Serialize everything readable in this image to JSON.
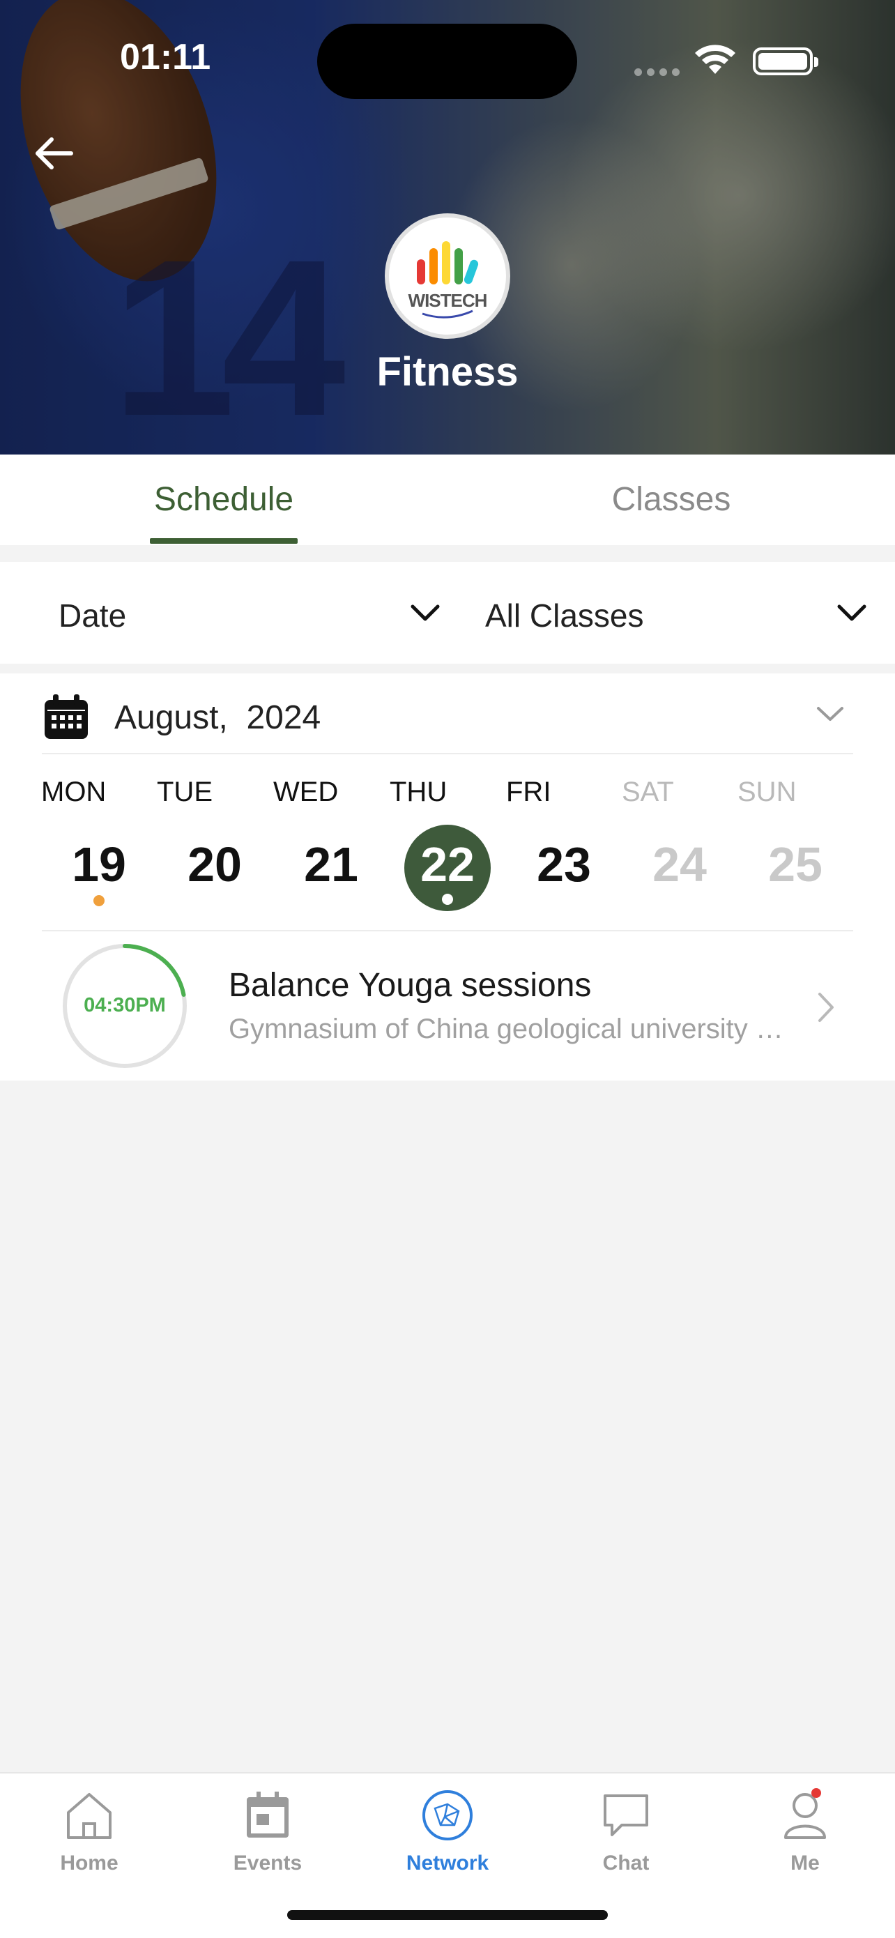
{
  "status_bar": {
    "time": "01:11"
  },
  "header": {
    "title": "Fitness",
    "logo_text": "WISTECH"
  },
  "tabs": [
    {
      "label": "Schedule",
      "active": true
    },
    {
      "label": "Classes",
      "active": false
    }
  ],
  "filters": {
    "date_label": "Date",
    "class_label": "All Classes"
  },
  "calendar": {
    "month_label": "August,  2024",
    "days": [
      {
        "name": "MON",
        "num": "19",
        "weekend": false,
        "selected": false,
        "dot": "#f0a03c"
      },
      {
        "name": "TUE",
        "num": "20",
        "weekend": false,
        "selected": false
      },
      {
        "name": "WED",
        "num": "21",
        "weekend": false,
        "selected": false
      },
      {
        "name": "THU",
        "num": "22",
        "weekend": false,
        "selected": true,
        "dot": "#ffffff"
      },
      {
        "name": "FRI",
        "num": "23",
        "weekend": false,
        "selected": false
      },
      {
        "name": "SAT",
        "num": "24",
        "weekend": true,
        "selected": false
      },
      {
        "name": "SUN",
        "num": "25",
        "weekend": true,
        "selected": false
      }
    ]
  },
  "event": {
    "time": "04:30PM",
    "title": "Balance Youga sessions",
    "location": "Gymnasium of China geological university Beijing",
    "progress": 0.22
  },
  "nav": [
    {
      "label": "Home",
      "icon": "home-icon",
      "active": false
    },
    {
      "label": "Events",
      "icon": "calendar-icon",
      "active": false
    },
    {
      "label": "Network",
      "icon": "network-icon",
      "active": true
    },
    {
      "label": "Chat",
      "icon": "chat-icon",
      "active": false
    },
    {
      "label": "Me",
      "icon": "person-icon",
      "active": false,
      "badge": true
    }
  ],
  "colors": {
    "accent": "#3d5f34",
    "nav_active": "#2f7fdc",
    "badge": "#e53935",
    "ring": "#4caf50"
  }
}
